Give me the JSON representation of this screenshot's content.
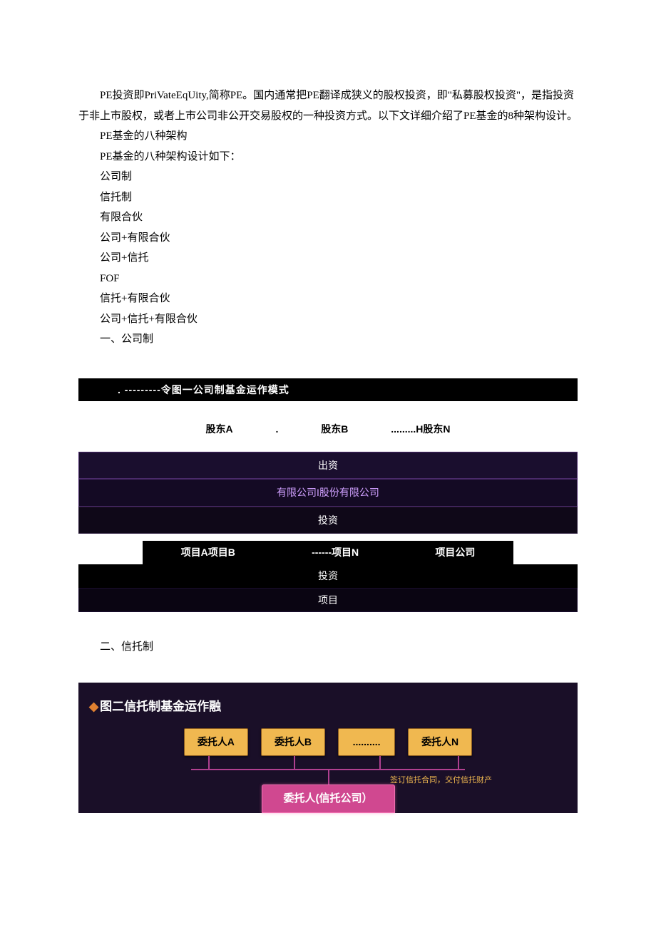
{
  "intro": "PE投资即PriVateEqUity,简称PE。国内通常把PE翻译成狭义的股权投资，即\"私募股权投资\"，是指投资于非上市股权，或者上市公司非公开交易股权的一种投资方式。以下文详细介绍了PE基金的8种架构设计。",
  "heading_intro1": "PE基金的八种架构",
  "heading_intro2": "PE基金的八种架构设计如下：",
  "list": {
    "i0": "公司制",
    "i1": "信托制",
    "i2": "有限合伙",
    "i3": "公司+有限合伙",
    "i4": "公司+信托",
    "i5": "FOF",
    "i6": "信托+有限合伙",
    "i7": "公司+信托+有限合伙"
  },
  "section1": "一、公司制",
  "diagram1": {
    "title": ". ---------令图一公司制基金运作模式",
    "shareholderA": "股东A",
    "dot": ".",
    "shareholderB": "股东B",
    "dots": ".........H股东N",
    "chuzi": "出资",
    "company": "有限公司I股份有限公司",
    "touzi1": "投资",
    "projAB": "项目A项目B",
    "projN": "------项目N",
    "projCo": "项目公司",
    "touzi2": "投资",
    "xiangmu": "项目"
  },
  "section2": "二、信托制",
  "diagram2": {
    "title": "图二信托制基金运作融",
    "trustorA": "委托人A",
    "trustorB": "委托人B",
    "trustorDots": "..........",
    "trustorN": "委托人N",
    "note": "签订信托合同，交付信托财产",
    "trustee": "委托人(信托公司）"
  }
}
